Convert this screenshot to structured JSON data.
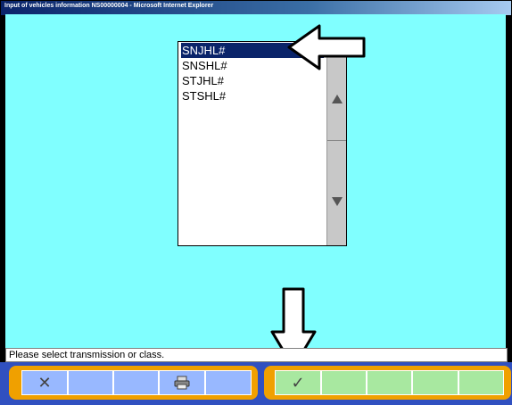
{
  "window": {
    "title": "Input of vehicles information  NS00000004 - Microsoft Internet Explorer"
  },
  "listbox": {
    "items": [
      {
        "label": "SNJHL#",
        "selected": true
      },
      {
        "label": "SNSHL#",
        "selected": false
      },
      {
        "label": "STJHL#",
        "selected": false
      },
      {
        "label": "STSHL#",
        "selected": false
      }
    ]
  },
  "status_bar": {
    "text": "Please select transmission or class."
  },
  "toolbar": {
    "left_group": [
      {
        "name": "cancel-button",
        "icon": "close-x-icon",
        "glyph": "✕"
      },
      {
        "name": "blank-button-1",
        "icon": "",
        "glyph": ""
      },
      {
        "name": "blank-button-2",
        "icon": "",
        "glyph": ""
      },
      {
        "name": "print-button",
        "icon": "printer-icon",
        "glyph": ""
      },
      {
        "name": "blank-button-3",
        "icon": "",
        "glyph": ""
      }
    ],
    "right_group": [
      {
        "name": "confirm-button",
        "icon": "checkmark-icon",
        "glyph": "✓"
      },
      {
        "name": "blank-button-4",
        "icon": "",
        "glyph": ""
      },
      {
        "name": "blank-button-5",
        "icon": "",
        "glyph": ""
      },
      {
        "name": "blank-button-6",
        "icon": "",
        "glyph": ""
      },
      {
        "name": "blank-button-7",
        "icon": "",
        "glyph": ""
      }
    ]
  },
  "colors": {
    "client_bg": "#80ffff",
    "selection": "#0a246a",
    "toolbar_bg": "#3050c0",
    "toolbar_group": "#f0a000"
  }
}
